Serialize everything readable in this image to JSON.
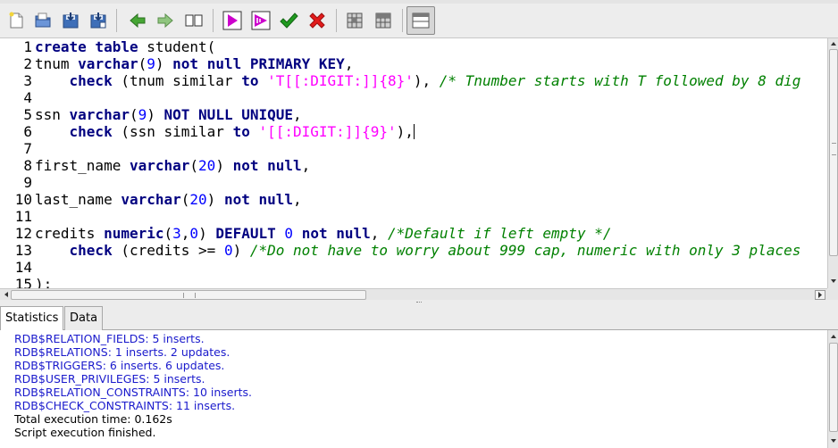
{
  "toolbar": {
    "buttons": [
      {
        "name": "new-file",
        "icon": "new-document-icon"
      },
      {
        "name": "open-file",
        "icon": "open-folder-icon"
      },
      {
        "name": "save-file",
        "icon": "save-icon"
      },
      {
        "name": "save-as",
        "icon": "save-as-icon"
      },
      {
        "name": "back",
        "icon": "arrow-left-icon"
      },
      {
        "name": "forward",
        "icon": "arrow-right-icon"
      },
      {
        "name": "bookmarks",
        "icon": "book-icon"
      },
      {
        "name": "execute",
        "icon": "play-icon"
      },
      {
        "name": "execute-step",
        "icon": "play-step-icon"
      },
      {
        "name": "commit",
        "icon": "check-icon"
      },
      {
        "name": "rollback",
        "icon": "x-icon"
      },
      {
        "name": "grid-1",
        "icon": "grid-icon"
      },
      {
        "name": "grid-2",
        "icon": "grid-alt-icon"
      },
      {
        "name": "toggle-panel",
        "icon": "panel-icon"
      }
    ],
    "colors": {
      "play": "#cc00cc",
      "check": "#1f9a1f",
      "x": "#e21b1b",
      "arrow": "#2f9a1f"
    }
  },
  "editor": {
    "line_numbers": [
      "1",
      "2",
      "3",
      "4",
      "5",
      "6",
      "7",
      "8",
      "9",
      "10",
      "11",
      "12",
      "13",
      "14",
      "15"
    ],
    "lines": [
      [
        {
          "t": "create table",
          "c": "kw"
        },
        {
          "t": " student(",
          "c": ""
        }
      ],
      [
        {
          "t": "tnum ",
          "c": ""
        },
        {
          "t": "varchar",
          "c": "kw"
        },
        {
          "t": "(",
          "c": ""
        },
        {
          "t": "9",
          "c": "num"
        },
        {
          "t": ") ",
          "c": ""
        },
        {
          "t": "not null PRIMARY KEY",
          "c": "kw"
        },
        {
          "t": ",",
          "c": ""
        }
      ],
      [
        {
          "t": "    ",
          "c": ""
        },
        {
          "t": "check",
          "c": "kw"
        },
        {
          "t": " (tnum similar ",
          "c": ""
        },
        {
          "t": "to",
          "c": "kw"
        },
        {
          "t": " ",
          "c": ""
        },
        {
          "t": "'T[[:DIGIT:]]{8}'",
          "c": "str"
        },
        {
          "t": "), ",
          "c": ""
        },
        {
          "t": "/* Tnumber starts with T followed by 8 dig",
          "c": "cmt"
        }
      ],
      [],
      [
        {
          "t": "ssn ",
          "c": ""
        },
        {
          "t": "varchar",
          "c": "kw"
        },
        {
          "t": "(",
          "c": ""
        },
        {
          "t": "9",
          "c": "num"
        },
        {
          "t": ") ",
          "c": ""
        },
        {
          "t": "NOT NULL UNIQUE",
          "c": "kw"
        },
        {
          "t": ",",
          "c": ""
        }
      ],
      [
        {
          "t": "    ",
          "c": ""
        },
        {
          "t": "check",
          "c": "kw"
        },
        {
          "t": " (ssn similar ",
          "c": ""
        },
        {
          "t": "to",
          "c": "kw"
        },
        {
          "t": " ",
          "c": ""
        },
        {
          "t": "'[[:DIGIT:]]{9}'",
          "c": "str"
        },
        {
          "t": "),",
          "c": ""
        },
        {
          "t": "|caret|",
          "c": "caret"
        }
      ],
      [],
      [
        {
          "t": "first_name ",
          "c": ""
        },
        {
          "t": "varchar",
          "c": "kw"
        },
        {
          "t": "(",
          "c": ""
        },
        {
          "t": "20",
          "c": "num"
        },
        {
          "t": ") ",
          "c": ""
        },
        {
          "t": "not null",
          "c": "kw"
        },
        {
          "t": ",",
          "c": ""
        }
      ],
      [],
      [
        {
          "t": "last_name ",
          "c": ""
        },
        {
          "t": "varchar",
          "c": "kw"
        },
        {
          "t": "(",
          "c": ""
        },
        {
          "t": "20",
          "c": "num"
        },
        {
          "t": ") ",
          "c": ""
        },
        {
          "t": "not null",
          "c": "kw"
        },
        {
          "t": ",",
          "c": ""
        }
      ],
      [],
      [
        {
          "t": "credits ",
          "c": ""
        },
        {
          "t": "numeric",
          "c": "kw"
        },
        {
          "t": "(",
          "c": ""
        },
        {
          "t": "3",
          "c": "num"
        },
        {
          "t": ",",
          "c": ""
        },
        {
          "t": "0",
          "c": "num"
        },
        {
          "t": ") ",
          "c": ""
        },
        {
          "t": "DEFAULT",
          "c": "kw"
        },
        {
          "t": " ",
          "c": ""
        },
        {
          "t": "0",
          "c": "num"
        },
        {
          "t": " ",
          "c": ""
        },
        {
          "t": "not null",
          "c": "kw"
        },
        {
          "t": ", ",
          "c": ""
        },
        {
          "t": "/*Default if left empty */",
          "c": "cmt"
        }
      ],
      [
        {
          "t": "    ",
          "c": ""
        },
        {
          "t": "check",
          "c": "kw"
        },
        {
          "t": " (credits >= ",
          "c": ""
        },
        {
          "t": "0",
          "c": "num"
        },
        {
          "t": ") ",
          "c": ""
        },
        {
          "t": "/*Do not have to worry about 999 cap, numeric with only 3 places",
          "c": "cmt"
        }
      ],
      [],
      [
        {
          "t": ");",
          "c": ""
        }
      ]
    ]
  },
  "tabs": [
    {
      "label": "Statistics",
      "active": true
    },
    {
      "label": "Data",
      "active": false
    }
  ],
  "output": {
    "lines": [
      {
        "text": "RDB$RELATION_FIELDS: 5 inserts.",
        "color": "blue"
      },
      {
        "text": "RDB$RELATIONS: 1 inserts. 2 updates.",
        "color": "blue"
      },
      {
        "text": "RDB$TRIGGERS: 6 inserts. 6 updates.",
        "color": "blue"
      },
      {
        "text": "RDB$USER_PRIVILEGES: 5 inserts.",
        "color": "blue"
      },
      {
        "text": "RDB$RELATION_CONSTRAINTS: 10 inserts.",
        "color": "blue"
      },
      {
        "text": "RDB$CHECK_CONSTRAINTS: 11 inserts.",
        "color": "blue"
      },
      {
        "text": "Total execution time: 0.162s",
        "color": "black"
      },
      {
        "text": "Script execution finished.",
        "color": "black"
      }
    ]
  }
}
